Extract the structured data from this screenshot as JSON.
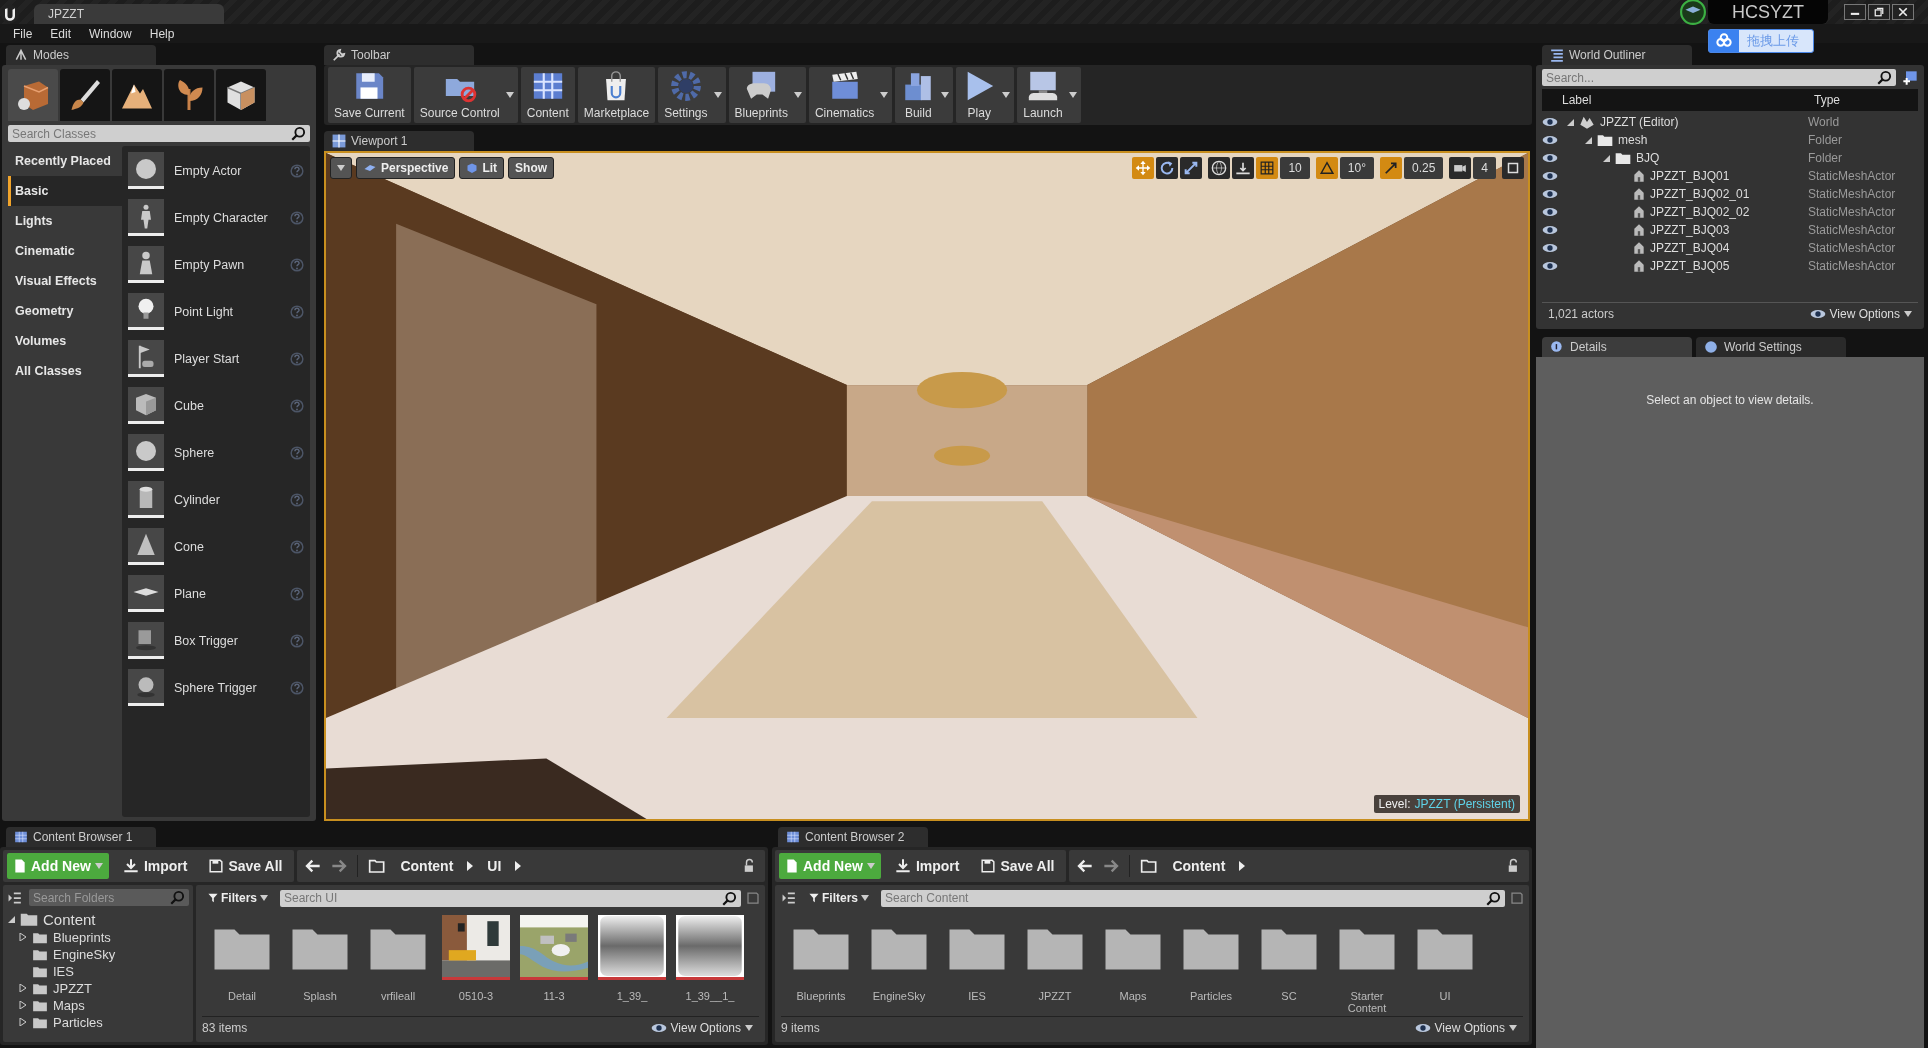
{
  "window": {
    "title": "JPZZT",
    "user": "HCSYZT",
    "upload_button": "拖拽上传"
  },
  "menu": [
    "File",
    "Edit",
    "Window",
    "Help"
  ],
  "modes": {
    "tab": "Modes",
    "mode_tabs": [
      {
        "kind": "place",
        "selected": true
      },
      {
        "kind": "paint",
        "selected": false
      },
      {
        "kind": "landscape",
        "selected": false
      },
      {
        "kind": "foliage",
        "selected": false
      },
      {
        "kind": "mesh",
        "selected": false
      }
    ],
    "search": {
      "placeholder": "Search Classes"
    },
    "categories": [
      {
        "label": "Recently Placed",
        "selected": false
      },
      {
        "label": "Basic",
        "selected": true
      },
      {
        "label": "Lights",
        "selected": false
      },
      {
        "label": "Cinematic",
        "selected": false
      },
      {
        "label": "Visual Effects",
        "selected": false
      },
      {
        "label": "Geometry",
        "selected": false
      },
      {
        "label": "Volumes",
        "selected": false
      },
      {
        "label": "All Classes",
        "selected": false
      }
    ],
    "items": [
      {
        "label": "Empty Actor",
        "kind": "sphere"
      },
      {
        "label": "Empty Character",
        "kind": "figure"
      },
      {
        "label": "Empty Pawn",
        "kind": "pawn"
      },
      {
        "label": "Point Light",
        "kind": "bulb"
      },
      {
        "label": "Player Start",
        "kind": "flag"
      },
      {
        "label": "Cube",
        "kind": "cube"
      },
      {
        "label": "Sphere",
        "kind": "sphere"
      },
      {
        "label": "Cylinder",
        "kind": "cylinder"
      },
      {
        "label": "Cone",
        "kind": "cone"
      },
      {
        "label": "Plane",
        "kind": "plane"
      },
      {
        "label": "Box Trigger",
        "kind": "box-trigger"
      },
      {
        "label": "Sphere Trigger",
        "kind": "sphere-trigger"
      }
    ]
  },
  "toolbar": {
    "tab": "Toolbar",
    "buttons": [
      {
        "label": "Save Current",
        "kind": "save",
        "dropdown": false
      },
      {
        "label": "Source Control",
        "kind": "source-control",
        "dropdown": true
      },
      {
        "label": "Content",
        "kind": "content",
        "dropdown": false
      },
      {
        "label": "Marketplace",
        "kind": "marketplace",
        "dropdown": false
      },
      {
        "label": "Settings",
        "kind": "settings",
        "dropdown": true
      },
      {
        "label": "Blueprints",
        "kind": "blueprints",
        "dropdown": true
      },
      {
        "label": "Cinematics",
        "kind": "cinematics",
        "dropdown": true
      },
      {
        "label": "Build",
        "kind": "build",
        "dropdown": true
      },
      {
        "label": "Play",
        "kind": "play",
        "dropdown": true
      },
      {
        "label": "Launch",
        "kind": "launch",
        "dropdown": true
      }
    ]
  },
  "viewport": {
    "tab": "Viewport 1",
    "view_buttons": [
      {
        "label": "Perspective",
        "kind": "perspective"
      },
      {
        "label": "Lit",
        "kind": "lit"
      },
      {
        "label": "Show",
        "kind": "show"
      }
    ],
    "transform_tools": [
      {
        "kind": "translate",
        "selected": true
      },
      {
        "kind": "rotate",
        "selected": false
      },
      {
        "kind": "scale",
        "selected": false
      }
    ],
    "snaps": [
      {
        "kind": "grid",
        "value": "10",
        "on": true
      },
      {
        "kind": "rotation",
        "value": "10°",
        "on": true
      },
      {
        "kind": "scale",
        "value": "0.25",
        "on": true
      },
      {
        "kind": "camera-speed",
        "value": "4",
        "on": false
      }
    ],
    "level_label": "Level:",
    "level_name": "JPZZT (Persistent)"
  },
  "outliner": {
    "tab": "World Outliner",
    "search": {
      "placeholder": "Search..."
    },
    "columns": [
      "Label",
      "Type"
    ],
    "rows": [
      {
        "label": "JPZZT (Editor)",
        "type": "World",
        "kind": "world",
        "expanded": true,
        "children": [
          {
            "label": "mesh",
            "type": "Folder",
            "kind": "folder",
            "expanded": true,
            "children": [
              {
                "label": "BJQ",
                "type": "Folder",
                "kind": "folder",
                "expanded": true,
                "children": [
                  {
                    "label": "JPZZT_BJQ01",
                    "type": "StaticMeshActor",
                    "kind": "mesh"
                  },
                  {
                    "label": "JPZZT_BJQ02_01",
                    "type": "StaticMeshActor",
                    "kind": "mesh"
                  },
                  {
                    "label": "JPZZT_BJQ02_02",
                    "type": "StaticMeshActor",
                    "kind": "mesh"
                  },
                  {
                    "label": "JPZZT_BJQ03",
                    "type": "StaticMeshActor",
                    "kind": "mesh"
                  },
                  {
                    "label": "JPZZT_BJQ04",
                    "type": "StaticMeshActor",
                    "kind": "mesh"
                  },
                  {
                    "label": "JPZZT_BJQ05",
                    "type": "StaticMeshActor",
                    "kind": "mesh"
                  }
                ]
              }
            ]
          }
        ]
      }
    ],
    "count": "1,021 actors",
    "view_options": "View Options"
  },
  "details": {
    "tabs": [
      {
        "label": "Details",
        "kind": "details",
        "selected": true
      },
      {
        "label": "World Settings",
        "kind": "world",
        "selected": false
      }
    ],
    "message": "Select an object to view details."
  },
  "content_browsers": [
    {
      "tab": "Content Browser 1",
      "add_new": "Add New",
      "import": "Import",
      "save_all": "Save All",
      "path": [
        "Content",
        "UI"
      ],
      "folder_search": {
        "placeholder": "Search Folders"
      },
      "folder_tree": [
        {
          "label": "Content",
          "expanded": true,
          "children": [
            {
              "label": "Blueprints",
              "expanded": false
            },
            {
              "label": "EngineSky"
            },
            {
              "label": "IES"
            },
            {
              "label": "JPZZT",
              "expanded": false
            },
            {
              "label": "Maps",
              "expanded": false
            },
            {
              "label": "Particles",
              "expanded": false
            }
          ]
        }
      ],
      "filters": "Filters",
      "search": {
        "placeholder": "Search UI"
      },
      "assets": [
        {
          "name": "Detail",
          "kind": "folder"
        },
        {
          "name": "Splash",
          "kind": "folder"
        },
        {
          "name": "vrfileall",
          "kind": "folder"
        },
        {
          "name": "0510-3",
          "kind": "room"
        },
        {
          "name": "11-3",
          "kind": "aerial"
        },
        {
          "name": "1_39_",
          "kind": "texture"
        },
        {
          "name": "1_39__1_",
          "kind": "texture"
        }
      ],
      "count": "83 items",
      "view_options": "View Options"
    },
    {
      "tab": "Content Browser 2",
      "add_new": "Add New",
      "import": "Import",
      "save_all": "Save All",
      "path": [
        "Content"
      ],
      "filters": "Filters",
      "search": {
        "placeholder": "Search Content"
      },
      "assets": [
        {
          "name": "Blueprints",
          "kind": "folder"
        },
        {
          "name": "EngineSky",
          "kind": "folder"
        },
        {
          "name": "IES",
          "kind": "folder"
        },
        {
          "name": "JPZZT",
          "kind": "folder"
        },
        {
          "name": "Maps",
          "kind": "folder"
        },
        {
          "name": "Particles",
          "kind": "folder"
        },
        {
          "name": "SC",
          "kind": "folder"
        },
        {
          "name": "Starter Content",
          "kind": "folder"
        },
        {
          "name": "UI",
          "kind": "folder"
        }
      ],
      "count": "9 items",
      "view_options": "View Options"
    }
  ]
}
